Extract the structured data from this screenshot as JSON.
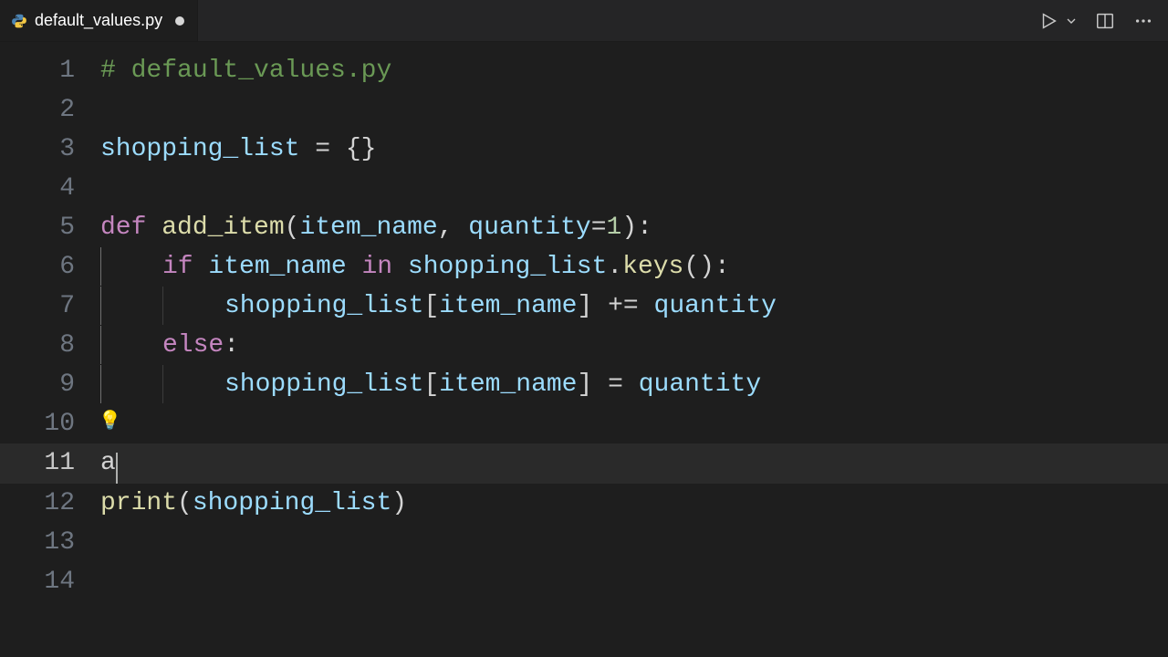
{
  "tab": {
    "filename": "default_values.py",
    "language": "python",
    "dirty": true
  },
  "editor": {
    "lines": [
      {
        "n": 1,
        "tokens": [
          {
            "t": "# default_values.py",
            "c": "comment"
          }
        ]
      },
      {
        "n": 2,
        "tokens": []
      },
      {
        "n": 3,
        "tokens": [
          {
            "t": "shopping_list",
            "c": "var"
          },
          {
            "t": " = ",
            "c": "op"
          },
          {
            "t": "{}",
            "c": "punct"
          }
        ]
      },
      {
        "n": 4,
        "tokens": []
      },
      {
        "n": 5,
        "tokens": [
          {
            "t": "def ",
            "c": "keyword"
          },
          {
            "t": "add_item",
            "c": "func"
          },
          {
            "t": "(",
            "c": "punct"
          },
          {
            "t": "item_name",
            "c": "param"
          },
          {
            "t": ", ",
            "c": "punct"
          },
          {
            "t": "quantity",
            "c": "param"
          },
          {
            "t": "=",
            "c": "op"
          },
          {
            "t": "1",
            "c": "num"
          },
          {
            "t": "):",
            "c": "punct"
          }
        ]
      },
      {
        "n": 6,
        "indent": 1,
        "guideActive": true,
        "tokens": [
          {
            "t": "if ",
            "c": "keyword"
          },
          {
            "t": "item_name",
            "c": "var"
          },
          {
            "t": " ",
            "c": "default"
          },
          {
            "t": "in ",
            "c": "keyword"
          },
          {
            "t": "shopping_list",
            "c": "var"
          },
          {
            "t": ".",
            "c": "punct"
          },
          {
            "t": "keys",
            "c": "func"
          },
          {
            "t": "():",
            "c": "punct"
          }
        ]
      },
      {
        "n": 7,
        "indent": 2,
        "guideActive": true,
        "tokens": [
          {
            "t": "shopping_list",
            "c": "var"
          },
          {
            "t": "[",
            "c": "punct"
          },
          {
            "t": "item_name",
            "c": "var"
          },
          {
            "t": "]",
            "c": "punct"
          },
          {
            "t": " += ",
            "c": "op"
          },
          {
            "t": "quantity",
            "c": "var"
          }
        ]
      },
      {
        "n": 8,
        "indent": 1,
        "guideActive": true,
        "tokens": [
          {
            "t": "else",
            "c": "keyword"
          },
          {
            "t": ":",
            "c": "punct"
          }
        ]
      },
      {
        "n": 9,
        "indent": 2,
        "guideActive": true,
        "tokens": [
          {
            "t": "shopping_list",
            "c": "var"
          },
          {
            "t": "[",
            "c": "punct"
          },
          {
            "t": "item_name",
            "c": "var"
          },
          {
            "t": "]",
            "c": "punct"
          },
          {
            "t": " = ",
            "c": "op"
          },
          {
            "t": "quantity",
            "c": "var"
          }
        ]
      },
      {
        "n": 10,
        "bulb": true,
        "tokens": []
      },
      {
        "n": 11,
        "current": true,
        "cursorAfter": true,
        "tokens": [
          {
            "t": "a",
            "c": "default"
          }
        ]
      },
      {
        "n": 12,
        "tokens": [
          {
            "t": "print",
            "c": "builtin"
          },
          {
            "t": "(",
            "c": "punct"
          },
          {
            "t": "shopping_list",
            "c": "var"
          },
          {
            "t": ")",
            "c": "punct"
          }
        ]
      },
      {
        "n": 13,
        "tokens": []
      },
      {
        "n": 14,
        "tokens": []
      }
    ],
    "indent_spaces": 4
  }
}
